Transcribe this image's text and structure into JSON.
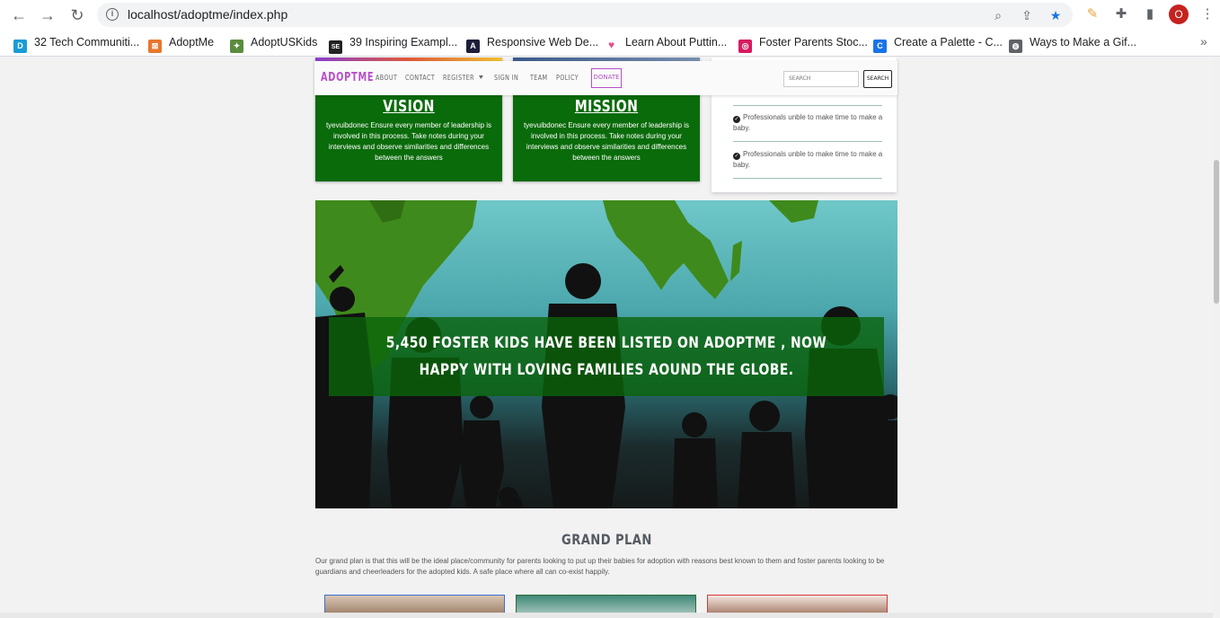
{
  "browser": {
    "url": "localhost/adoptme/index.php",
    "avatar_letter": "O",
    "bookmarks": [
      {
        "label": "32 Tech Communiti...",
        "color": "#1a9bd7",
        "glyph": "D"
      },
      {
        "label": "AdoptMe",
        "color": "#e8772e",
        "glyph": "⊠"
      },
      {
        "label": "AdoptUSKids",
        "color": "#5b8c3e",
        "glyph": "✦"
      },
      {
        "label": "39 Inspiring Exampl...",
        "color": "#222222",
        "glyph": "SE"
      },
      {
        "label": "Responsive Web De...",
        "color": "#1d1d3a",
        "glyph": "A"
      },
      {
        "label": "Learn About Puttin...",
        "color": "#e4508c",
        "glyph": "♥"
      },
      {
        "label": "Foster Parents Stoc...",
        "color": "#d81b60",
        "glyph": "◎"
      },
      {
        "label": "Create a Palette - C...",
        "color": "#1a73e8",
        "glyph": "C"
      },
      {
        "label": "Ways to Make a Gif...",
        "color": "#5f6368",
        "glyph": "◍"
      }
    ]
  },
  "site_nav": {
    "brand": "ADOPTME",
    "links": [
      "ABOUT",
      "CONTACT",
      "REGISTER",
      "SIGN IN",
      "TEAM",
      "POLICY"
    ],
    "donate": "DONATE",
    "search_placeholder": "SEARCH",
    "search_button": "SEARCH"
  },
  "vision": {
    "title": "VISION",
    "text": "tyevuibdonec Ensure every member of leadership is involved in this process. Take notes during your interviews and observe similarities and differences between the answers"
  },
  "mission": {
    "title": "MISSION",
    "text": "tyevuibdonec Ensure every member of leadership is involved in this process. Take notes during your interviews and observe similarities and differences between the answers"
  },
  "side_list": [
    "Professionals unble to make time to make a baby.",
    "Professionals unble to make time to make a baby."
  ],
  "hero": {
    "text": "5,450 FOSTER KIDS HAVE BEEN LISTED ON ADOPTME , NOW HAPPY WITH LOVING FAMILIES AOUND THE GLOBE."
  },
  "grand_plan": {
    "title": "GRAND PLAN",
    "text": "Our grand plan is that this will be the ideal place/community for parents looking to put up their babies for adoption with reasons best known to them and foster parents looking to be guardians and cheerleaders for the adopted kids. A safe place where all can co-exist happily."
  },
  "colors": {
    "card_green": "#0a6b0a",
    "brand_purple": "#b64fc8"
  }
}
